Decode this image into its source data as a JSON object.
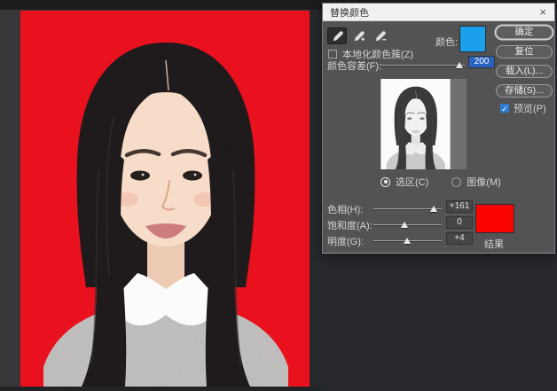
{
  "window": {
    "title": "替换颜色",
    "close_glyph": "×"
  },
  "dialog": {
    "tools": [
      {
        "name": "eyedropper",
        "pressed": true
      },
      {
        "name": "eyedropper-plus",
        "pressed": false
      },
      {
        "name": "eyedropper-minus",
        "pressed": false
      }
    ],
    "localized_clusters_label": "本地化颜色簇(Z)",
    "localized_clusters_checked": false,
    "color_label": "颜色:",
    "color_swatch": "#1ba1ec",
    "fuzziness": {
      "label": "颜色容差(F):",
      "value": "200",
      "pos": "94%"
    },
    "preview_modes": {
      "selection": "选区(C)",
      "image": "图像(M)",
      "selected": "selection"
    },
    "sliders": [
      {
        "label": "色相(H):",
        "value": "+161",
        "pos": "88%"
      },
      {
        "label": "饱和度(A):",
        "value": "0",
        "pos": "45%"
      },
      {
        "label": "明度(G):",
        "value": "+4",
        "pos": "49%"
      }
    ],
    "result_label": "结果",
    "result_swatch": "#fb0404",
    "buttons": {
      "ok": "确定",
      "reset": "复位",
      "load": "载入(L)...",
      "save": "存储(S)..."
    },
    "preview_checkbox": {
      "label": "预览(P)",
      "checked": true,
      "check_glyph": "✓",
      "accent": "#2f7cd6"
    }
  },
  "photo": {
    "palette": {
      "bg": "#e8111d",
      "hair": "#1f1a1b",
      "hair2": "#362e30",
      "skin": "#f6dcc9",
      "skin2": "#eccab4",
      "sweater": "#cbc9c7",
      "collar": "#fbfbfb",
      "brow": "#453630",
      "eye": "#26201d",
      "nose": "#d8a78f",
      "lips": "#cd7e7c",
      "blush": "#f0b9a6"
    }
  },
  "mask_preview": {
    "palette": {
      "bg": "#fbfbfb",
      "hair": "#3a3a3a",
      "hair2": "#555555",
      "skin": "#f2f2f2",
      "skin2": "#e3e3e3",
      "sweater": "#d8d8d8",
      "collar": "#eeeeee",
      "brow": "#8d8d8d",
      "eye": "#6f6f6f",
      "nose": "#d4d4d4",
      "lips": "#d2d2d2",
      "blush": "#e9e9e9"
    }
  }
}
